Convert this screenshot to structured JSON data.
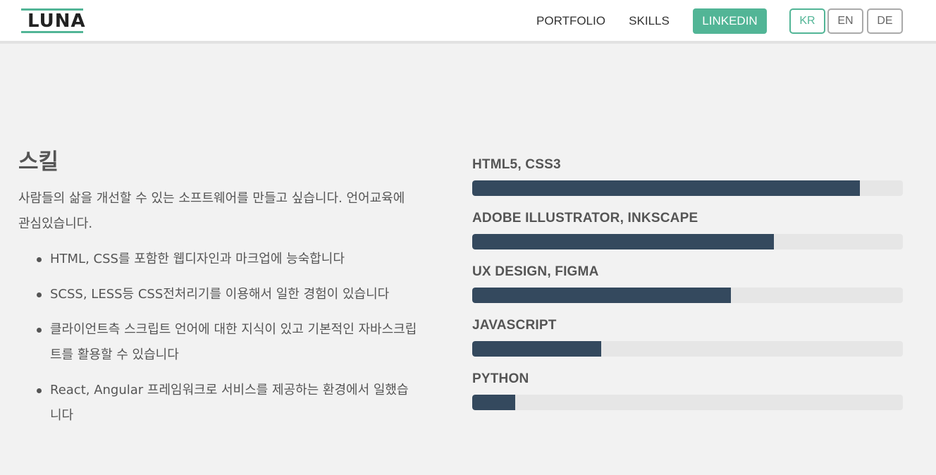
{
  "colors": {
    "accent": "#52b596",
    "bar_fill": "#34495e",
    "bar_track": "#e6e6e6",
    "page_bg": "#f2f2f2"
  },
  "header": {
    "logo_text": "LUNA",
    "nav": {
      "portfolio": "PORTFOLIO",
      "skills": "SKILLS",
      "linkedin": "LINKEDIN"
    },
    "languages": {
      "kr": "KR",
      "en": "EN",
      "de": "DE",
      "active": "KR"
    }
  },
  "skills_section": {
    "title": "스킬",
    "intro": "사람들의 삶을 개선할 수 있는 소프트웨어를 만들고 싶습니다. 언어교육에 관심있습니다.",
    "bullets": [
      "HTML, CSS를 포함한 웹디자인과 마크업에 능숙합니다",
      "SCSS, LESS등 CSS전처리기를 이용해서 일한 경험이 있습니다",
      "클라이언트측 스크립트 언어에 대한 지식이 있고 기본적인 자바스크립트를 활용할 수 있습니다",
      "React, Angular 프레임워크로 서비스를 제공하는 환경에서 일했습니다"
    ],
    "bars": [
      {
        "label": "HTML5, CSS3",
        "percent": 90
      },
      {
        "label": "ADOBE ILLUSTRATOR, INKSCAPE",
        "percent": 70
      },
      {
        "label": "UX DESIGN, FIGMA",
        "percent": 60
      },
      {
        "label": "JAVASCRIPT",
        "percent": 30
      },
      {
        "label": "PYTHON",
        "percent": 10
      }
    ]
  }
}
